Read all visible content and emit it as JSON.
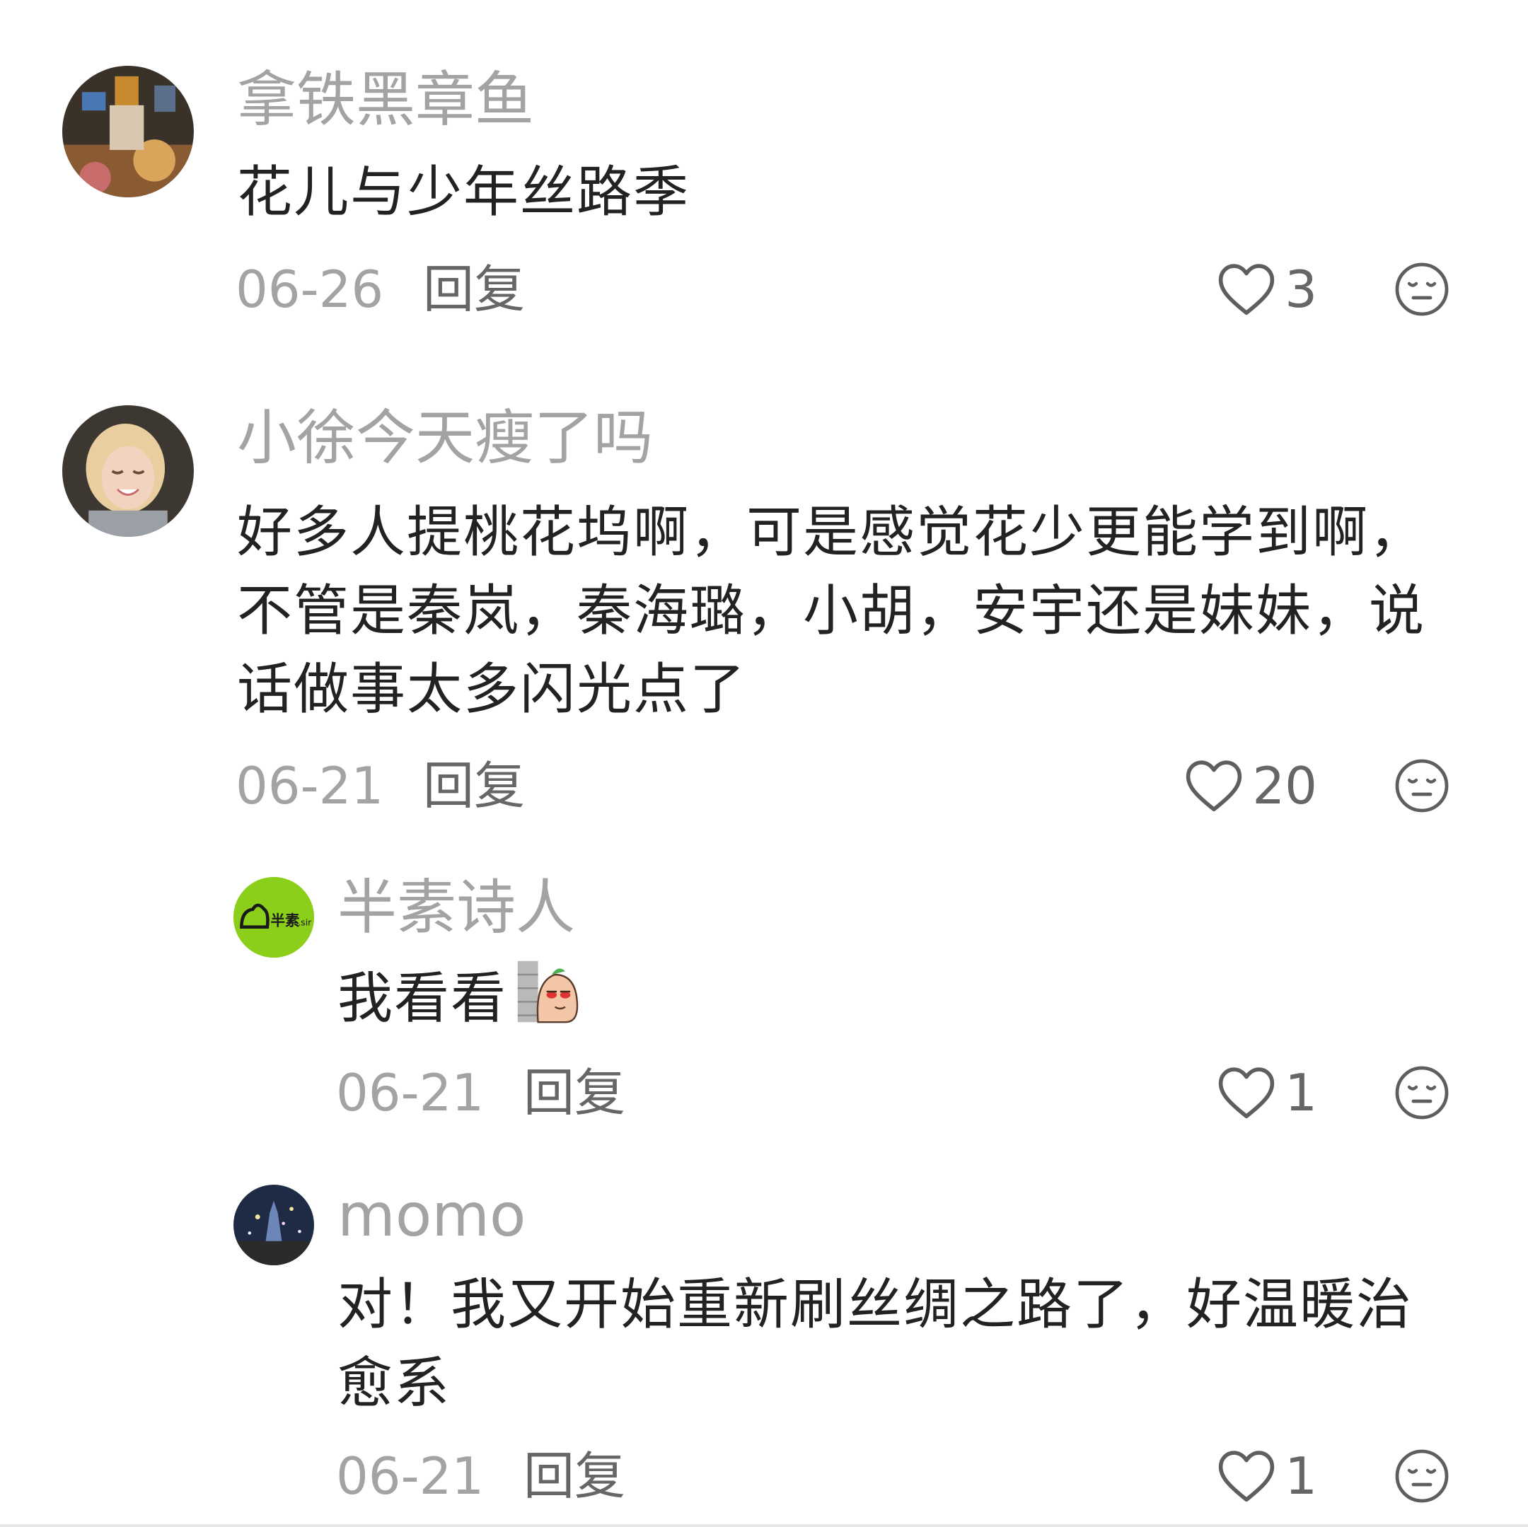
{
  "comments": [
    {
      "username": "拿铁黑章鱼",
      "content": "花儿与少年丝路季",
      "date": "06-26",
      "reply_label": "回复",
      "likes": "3",
      "avatar_icon": "user-avatar-icon"
    },
    {
      "username": "小徐今天瘦了吗",
      "content": "好多人提桃花坞啊，可是感觉花少更能学到啊，不管是秦岚，秦海璐，小胡，安宇还是妹妹，说话做事太多闪光点了",
      "date": "06-21",
      "reply_label": "回复",
      "likes": "20",
      "avatar_icon": "user-avatar-icon"
    }
  ],
  "replies": [
    {
      "username": "半素诗人",
      "content": "我看看",
      "sticker": "peeking-sticker-icon",
      "avatar_text": "半素.sir",
      "date": "06-21",
      "reply_label": "回复",
      "likes": "1",
      "avatar_color": "#8ccf1a"
    },
    {
      "username": "momo",
      "content": "对！我又开始重新刷丝绸之路了，好温暖治愈系",
      "date": "06-21",
      "reply_label": "回复",
      "likes": "1",
      "avatar_icon": "user-avatar-icon"
    }
  ],
  "colors": {
    "username": "#a3a3a3",
    "content": "#222222",
    "meta": "#666666",
    "date": "#a3a3a3",
    "avatar_green": "#8ccf1a"
  },
  "icons": {
    "like": "heart-outline-icon",
    "dislike": "dislike-face-icon"
  }
}
